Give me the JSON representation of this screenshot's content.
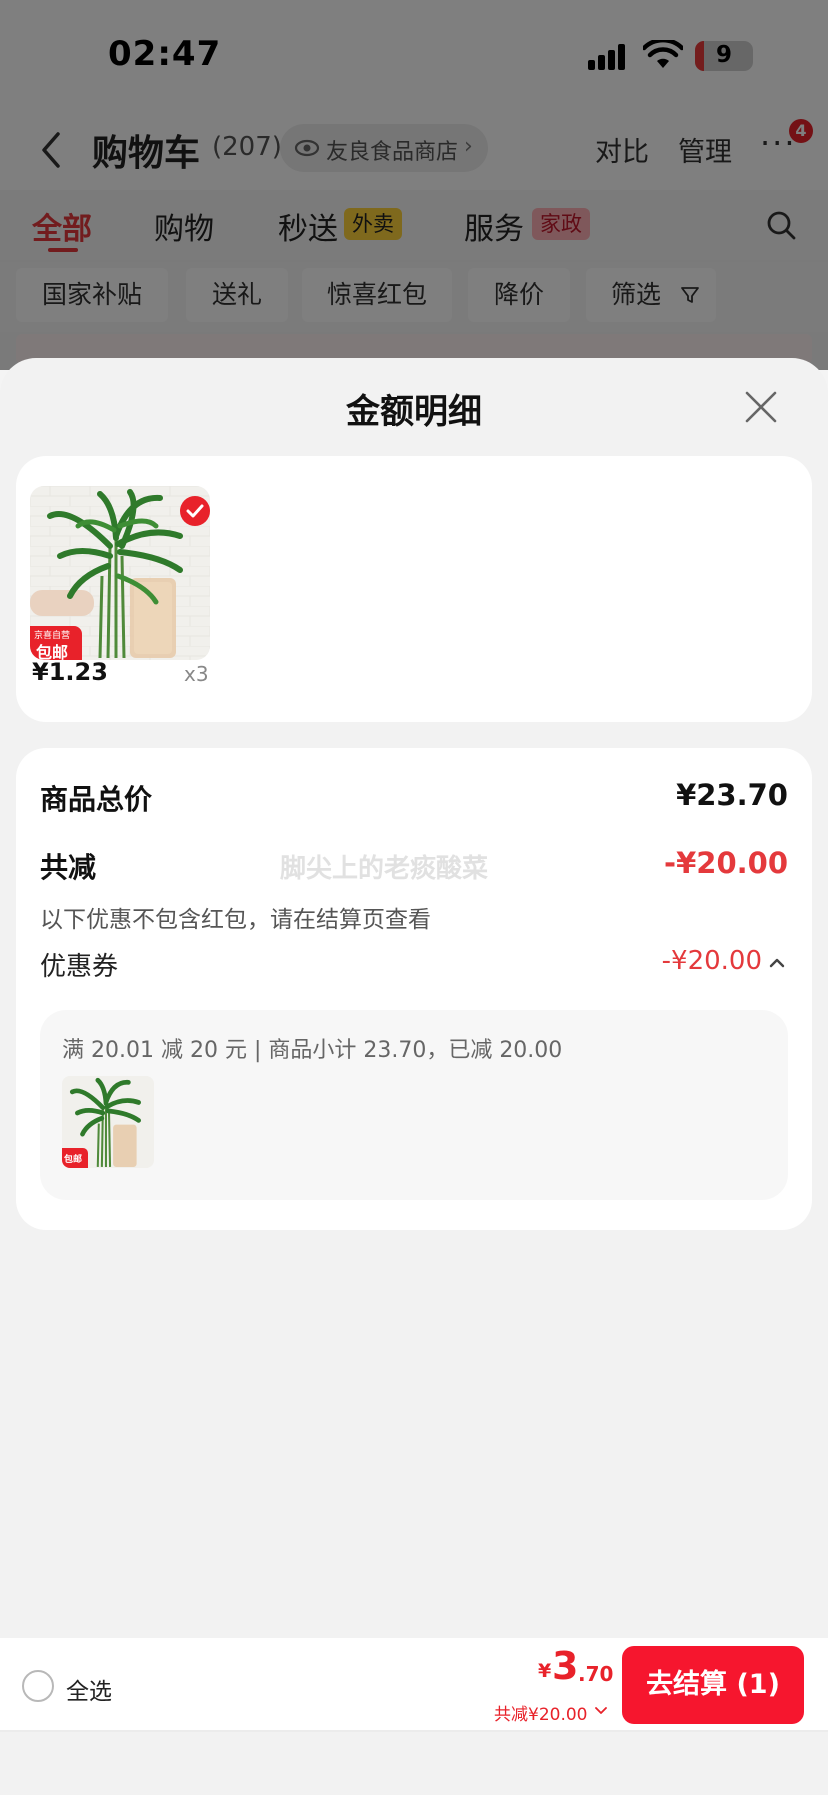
{
  "status_bar": {
    "time": "02:47",
    "battery": "9"
  },
  "nav": {
    "title": "购物车",
    "count": "(207)",
    "store": "友良食品商店",
    "compare": "对比",
    "manage": "管理",
    "more": "···",
    "badge": "4"
  },
  "tabs": [
    {
      "label": "全部",
      "active": true
    },
    {
      "label": "购物"
    },
    {
      "label": "秒送",
      "tag": "外卖"
    },
    {
      "label": "服务",
      "tag": "家政"
    }
  ],
  "filter_chips": [
    "国家补贴",
    "送礼",
    "惊喜红包",
    "降价",
    "筛选"
  ],
  "sheet": {
    "title": "金额明细",
    "item": {
      "tag_top": "京喜自营",
      "tag_bottom": "包邮",
      "price": "¥1.23",
      "quantity": "x3"
    },
    "summary": {
      "total_label": "商品总价",
      "total_value": "¥23.70",
      "discount_label": "共减",
      "discount_value": "-¥20.00",
      "discount_note": "以下优惠不包含红包，请在结算页查看",
      "watermark": "脚尖上的老痰酸菜",
      "coupon_label": "优惠券",
      "coupon_value": "-¥20.00",
      "coupon_rule": "满 20.01 减 20 元 | 商品小计 23.70，已减 20.00",
      "coupon_item_tag": "包邮"
    }
  },
  "bottom_bar": {
    "select_all": "全选",
    "price_yen": "¥",
    "price_int": "3",
    "price_dec": ".70",
    "discount_line": "共减¥20.00",
    "checkout": "去结算 (1)"
  },
  "colors": {
    "accent_red": "#e4393c",
    "button_red": "#f6162e"
  }
}
